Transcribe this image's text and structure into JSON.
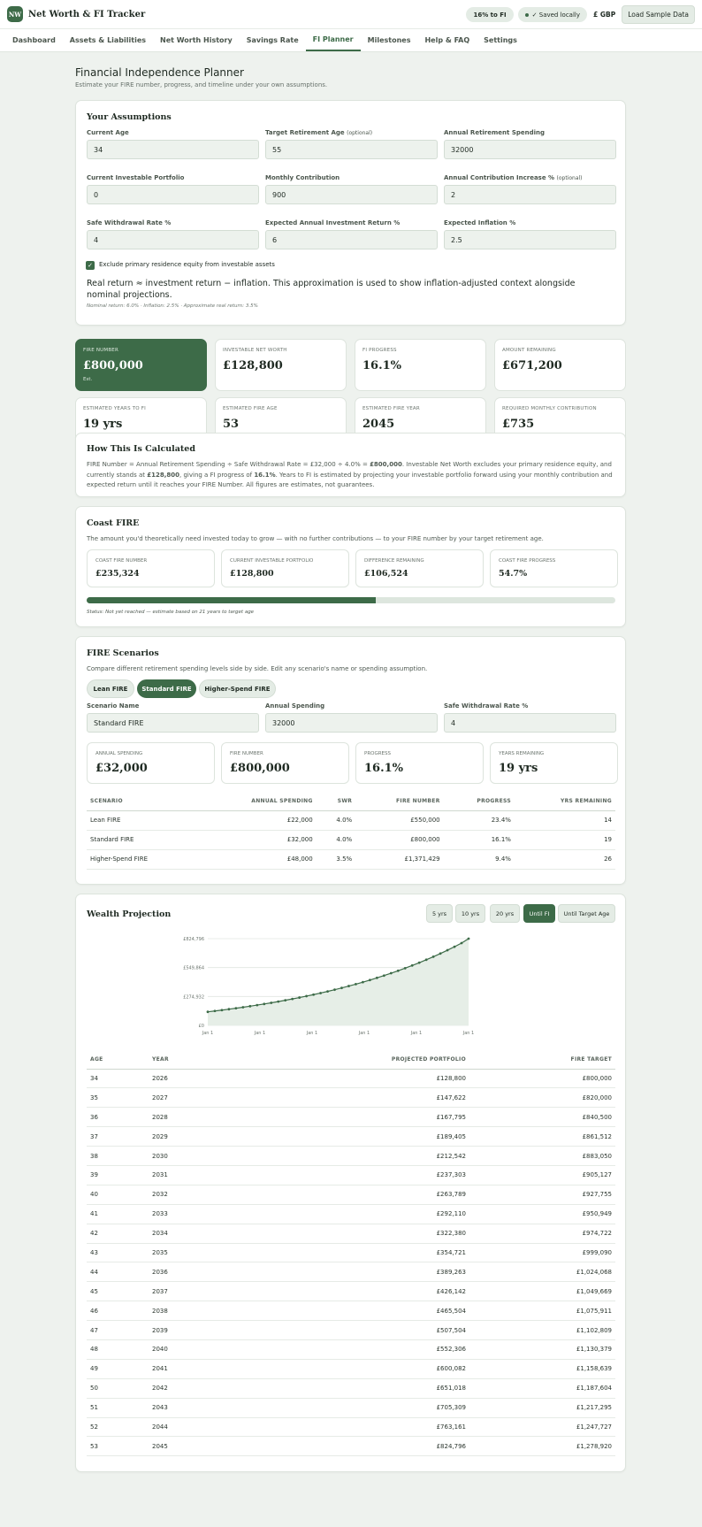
{
  "app": {
    "logo": "NW",
    "title": "Net Worth & FI Tracker"
  },
  "header": {
    "fi_badge": "16% to FI",
    "saved": "✓ Saved locally",
    "currency": "£ GBP",
    "load_sample": "Load Sample Data"
  },
  "nav": {
    "items": [
      "Dashboard",
      "Assets & Liabilities",
      "Net Worth History",
      "Savings Rate",
      "FI Planner",
      "Milestones",
      "Help & FAQ",
      "Settings"
    ],
    "active": "FI Planner"
  },
  "page": {
    "title": "Financial Independence Planner",
    "subtitle": "Estimate your FIRE number, progress, and timeline under your own assumptions."
  },
  "assumptions": {
    "heading": "Your Assumptions",
    "fields": [
      {
        "label": "Current Age",
        "optional": "",
        "value": "34"
      },
      {
        "label": "Target Retirement Age",
        "optional": "(optional)",
        "value": "55"
      },
      {
        "label": "Annual Retirement Spending",
        "optional": "",
        "value": "32000"
      },
      {
        "label": "Current Investable Portfolio",
        "optional": "",
        "value": "0"
      },
      {
        "label": "Monthly Contribution",
        "optional": "",
        "value": "900"
      },
      {
        "label": "Annual Contribution Increase %",
        "optional": "(optional)",
        "value": "2"
      },
      {
        "label": "Safe Withdrawal Rate %",
        "optional": "",
        "value": "4"
      },
      {
        "label": "Expected Annual Investment Return %",
        "optional": "",
        "value": "6"
      },
      {
        "label": "Expected Inflation %",
        "optional": "",
        "value": "2.5"
      }
    ],
    "exclude_label": "Exclude primary residence equity from investable assets",
    "exclude_checked": true,
    "real_return_note": "Real return ≈ investment return − inflation. This approximation is used to show inflation-adjusted context alongside nominal projections.",
    "rates_note": "Nominal return: 6.0% · Inflation: 2.5% · Approximate real return: 3.5%"
  },
  "stats": [
    {
      "label": "FIRE NUMBER",
      "value": "£800,000",
      "sub": "Est."
    },
    {
      "label": "INVESTABLE NET WORTH",
      "value": "£128,800",
      "sub": ""
    },
    {
      "label": "FI PROGRESS",
      "value": "16.1%",
      "sub": ""
    },
    {
      "label": "AMOUNT REMAINING",
      "value": "£671,200",
      "sub": ""
    },
    {
      "label": "ESTIMATED YEARS TO FI",
      "value": "19 yrs",
      "sub": "Est."
    },
    {
      "label": "ESTIMATED FIRE AGE",
      "value": "53",
      "sub": "Est."
    },
    {
      "label": "ESTIMATED FIRE YEAR",
      "value": "2045",
      "sub": "Est."
    },
    {
      "label": "REQUIRED MONTHLY CONTRIBUTION",
      "value": "£735",
      "sub": "To hit target age"
    }
  ],
  "calc": {
    "heading": "How This Is Calculated",
    "p1": "FIRE Number = Annual Retirement Spending ÷ Safe Withdrawal Rate = £32,000 ÷ 4.0% = ",
    "b1": "£800,000",
    "p2": ". Investable Net Worth excludes your primary residence equity, and currently stands at ",
    "b2": "£128,800",
    "p3": ", giving a FI progress of ",
    "b3": "16.1%",
    "p4": ". Years to FI is estimated by projecting your investable portfolio forward using your monthly contribution and expected return until it reaches your FIRE Number. All figures are estimates, not guarantees."
  },
  "coast": {
    "heading": "Coast FIRE",
    "desc": "The amount you'd theoretically need invested today to grow — with no further contributions — to your FIRE number by your target retirement age.",
    "cards": [
      {
        "label": "COAST FIRE NUMBER",
        "value": "£235,324"
      },
      {
        "label": "CURRENT INVESTABLE PORTFOLIO",
        "value": "£128,800"
      },
      {
        "label": "DIFFERENCE REMAINING",
        "value": "£106,524"
      },
      {
        "label": "COAST FIRE PROGRESS",
        "value": "54.7%"
      }
    ],
    "progress": 0.547,
    "status": "Status: Not yet reached — estimate based on 21 years to target age"
  },
  "scenarios": {
    "heading": "FIRE Scenarios",
    "desc": "Compare different retirement spending levels side by side. Edit any scenario's name or spending assumption.",
    "tabs": [
      "Lean FIRE",
      "Standard FIRE",
      "Higher-Spend FIRE"
    ],
    "active_tab": "Standard FIRE",
    "name_label": "Scenario Name",
    "name_value": "Standard FIRE",
    "spend_label": "Annual Spending",
    "spend_value": "32000",
    "swr_label": "Safe Withdrawal Rate %",
    "swr_value": "4",
    "cards": [
      {
        "label": "ANNUAL SPENDING",
        "value": "£32,000"
      },
      {
        "label": "FIRE NUMBER",
        "value": "£800,000"
      },
      {
        "label": "PROGRESS",
        "value": "16.1%"
      },
      {
        "label": "YEARS REMAINING",
        "value": "19 yrs"
      }
    ],
    "columns": [
      "SCENARIO",
      "ANNUAL SPENDING",
      "SWR",
      "FIRE NUMBER",
      "PROGRESS",
      "YRS REMAINING"
    ],
    "rows": [
      [
        "Lean FIRE",
        "£22,000",
        "4.0%",
        "£550,000",
        "23.4%",
        "14"
      ],
      [
        "Standard FIRE",
        "£32,000",
        "4.0%",
        "£800,000",
        "16.1%",
        "19"
      ],
      [
        "Higher-Spend FIRE",
        "£48,000",
        "3.5%",
        "£1,371,429",
        "9.4%",
        "26"
      ]
    ]
  },
  "projection": {
    "heading": "Wealth Projection",
    "ranges": [
      "5 yrs",
      "10 yrs",
      "20 yrs",
      "Until FI",
      "Until Target Age"
    ],
    "active_range": "Until FI",
    "columns": [
      "AGE",
      "YEAR",
      "PROJECTED PORTFOLIO",
      "FIRE TARGET"
    ],
    "rows": [
      [
        "34",
        "2026",
        "£128,800",
        "£800,000"
      ],
      [
        "35",
        "2027",
        "£147,622",
        "£820,000"
      ],
      [
        "36",
        "2028",
        "£167,795",
        "£840,500"
      ],
      [
        "37",
        "2029",
        "£189,405",
        "£861,512"
      ],
      [
        "38",
        "2030",
        "£212,542",
        "£883,050"
      ],
      [
        "39",
        "2031",
        "£237,303",
        "£905,127"
      ],
      [
        "40",
        "2032",
        "£263,789",
        "£927,755"
      ],
      [
        "41",
        "2033",
        "£292,110",
        "£950,949"
      ],
      [
        "42",
        "2034",
        "£322,380",
        "£974,722"
      ],
      [
        "43",
        "2035",
        "£354,721",
        "£999,090"
      ],
      [
        "44",
        "2036",
        "£389,263",
        "£1,024,068"
      ],
      [
        "45",
        "2037",
        "£426,142",
        "£1,049,669"
      ],
      [
        "46",
        "2038",
        "£465,504",
        "£1,075,911"
      ],
      [
        "47",
        "2039",
        "£507,504",
        "£1,102,809"
      ],
      [
        "48",
        "2040",
        "£552,306",
        "£1,130,379"
      ],
      [
        "49",
        "2041",
        "£600,082",
        "£1,158,639"
      ],
      [
        "50",
        "2042",
        "£651,018",
        "£1,187,604"
      ],
      [
        "51",
        "2043",
        "£705,309",
        "£1,217,295"
      ],
      [
        "52",
        "2044",
        "£763,161",
        "£1,247,727"
      ],
      [
        "53",
        "2045",
        "£824,796",
        "£1,278,920"
      ]
    ]
  },
  "chart_data": {
    "type": "area",
    "series": [
      {
        "values": [
          128800,
          136900,
          145300,
          154000,
          163100,
          172600,
          182500,
          192800,
          203500,
          214700,
          226400,
          238600,
          251300,
          264500,
          278300,
          292600,
          307500,
          323100,
          339300,
          356200,
          373800,
          392100,
          411200,
          431100,
          451900,
          473500,
          496100,
          519600,
          544100,
          569700,
          596400,
          624200,
          653200,
          683500,
          715100,
          748100,
          782500,
          824796
        ]
      }
    ],
    "y_ticks": [
      "£0",
      "£274,932",
      "£549,864",
      "£824,796"
    ],
    "x_ticks": [
      "Jan 1",
      "Jan 1",
      "Jan 1",
      "Jan 1",
      "Jan 1",
      "Jan 1"
    ],
    "ylim": [
      0,
      824796
    ],
    "grid": true,
    "colors": {
      "line": "#3d6b48",
      "fill": "#e6eee7"
    }
  }
}
